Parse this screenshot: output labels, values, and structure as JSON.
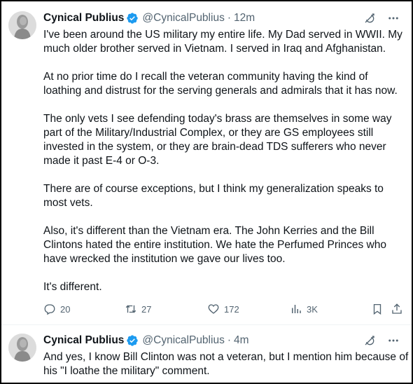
{
  "tweets": [
    {
      "author": {
        "name": "Cynical Publius",
        "handle": "@CynicalPublius",
        "avatar_icon": "avatar-icon"
      },
      "separator": "·",
      "time": "12m",
      "paragraphs": [
        "I've been around the US military my entire life.  My Dad served in WWII.  My much older brother served in Vietnam.  I served in Iraq and Afghanistan.",
        "At no prior time do I recall the veteran community having the kind of loathing and distrust for the serving generals and admirals that it has now.",
        "The only vets I see defending today's brass are themselves in some way part of the Military/Industrial Complex, or they are GS employees still invested in the system, or they are brain-dead TDS sufferers who never made it past E-4 or O-3.",
        "There are of course exceptions, but I think my generalization speaks to most vets.",
        "Also, it's different than the Vietnam era.  The John Kerries and the Bill Clintons hated the entire institution.  We hate the Perfumed Princes who have wrecked the institution we gave our lives too.",
        "It's different."
      ],
      "stats": {
        "replies": "20",
        "retweets": "27",
        "likes": "172",
        "views": "3K"
      }
    },
    {
      "author": {
        "name": "Cynical Publius",
        "handle": "@CynicalPublius",
        "avatar_icon": "avatar-icon"
      },
      "separator": "·",
      "time": "4m",
      "paragraphs": [
        "And yes, I know Bill Clinton was not a veteran, but I mention him because of his \"I loathe the military\" comment."
      ]
    }
  ],
  "colors": {
    "text": "#0f1419",
    "muted": "#536471",
    "verified_blue": "#1d9bf0",
    "frame": "#000000"
  }
}
